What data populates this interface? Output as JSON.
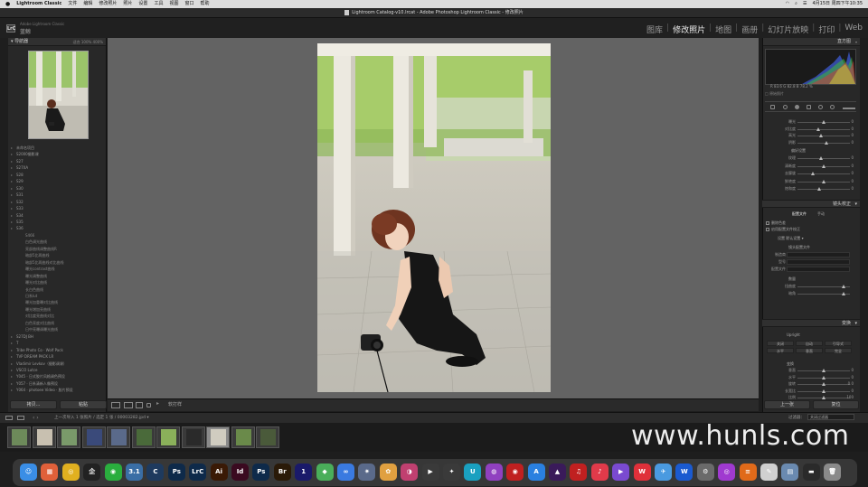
{
  "menubar": {
    "apple": "",
    "app_name": "Lightroom Classic",
    "menus": [
      "文件",
      "编辑",
      "修改照片",
      "照片",
      "设置",
      "工具",
      "视图",
      "窗口",
      "帮助"
    ],
    "clock": "4月15日 周四下午10:35"
  },
  "window": {
    "title": "Lightroom Catalog-v10.lrcat - Adobe Photoshop Lightroom Classic - 修改照片"
  },
  "identity": {
    "badge": "LrC",
    "line1": "Adobe Lightroom Classic",
    "line2": "蓝鲸"
  },
  "modules": {
    "items": [
      "图库",
      "修改照片",
      "地图",
      "画册",
      "幻灯片放映",
      "打印",
      "Web"
    ],
    "active": "修改照片"
  },
  "left_panel": {
    "navigator_label": "导航器",
    "navigator_opts": "适合  100%  400%",
    "folders": [
      {
        "label": "未命名项目",
        "sub": false
      },
      {
        "label": "S2000摄影课",
        "sub": false
      },
      {
        "label": "S27",
        "sub": false
      },
      {
        "label": "S27XA",
        "sub": false
      },
      {
        "label": "S28",
        "sub": false
      },
      {
        "label": "S29",
        "sub": false
      },
      {
        "label": "S30",
        "sub": false
      },
      {
        "label": "S31",
        "sub": false
      },
      {
        "label": "S32",
        "sub": false
      },
      {
        "label": "S33",
        "sub": false
      },
      {
        "label": "S34",
        "sub": false
      },
      {
        "label": "S35",
        "sub": false
      },
      {
        "label": "S36",
        "sub": false
      },
      {
        "label": "S466",
        "sub": true
      },
      {
        "label": "白色调光曲线",
        "sub": true
      },
      {
        "label": "亮部曲线调整曲线R",
        "sub": true
      },
      {
        "label": "暗部5比两曲线",
        "sub": true
      },
      {
        "label": "暗部5比两曲线对比曲线",
        "sub": true
      },
      {
        "label": "曝光contrast曲线",
        "sub": true
      },
      {
        "label": "曝光调整曲线",
        "sub": true
      },
      {
        "label": "曝光对比曲线",
        "sub": true
      },
      {
        "label": "长白色曲线",
        "sub": true
      },
      {
        "label": "日系lut",
        "sub": true
      },
      {
        "label": "曝光加重曝对比曲线",
        "sub": true
      },
      {
        "label": "曝光增加亮曲线",
        "sub": true
      },
      {
        "label": "对比度亮曲线对比",
        "sub": true
      },
      {
        "label": "白色亮度对比曲线",
        "sub": true
      },
      {
        "label": "日中亮曝调曝光曲线",
        "sub": true
      },
      {
        "label": "S27DJ BH",
        "sub": false
      },
      {
        "label": "T",
        "sub": false
      },
      {
        "label": "Tribe Photo Co · Wolf Pack",
        "sub": false
      },
      {
        "label": "TVP DREAM PACK LR",
        "sub": false
      },
      {
        "label": "Vladimir Levkov（摄影调课）",
        "sub": false
      },
      {
        "label": "VSCO Lutce",
        "sub": false
      },
      {
        "label": "Y045 · 日式胶片风格调色预设",
        "sub": false
      },
      {
        "label": "Y057 · 日系清新人像预设",
        "sub": false
      },
      {
        "label": "Y064 · photoee Video · 胶片预设",
        "sub": false
      }
    ],
    "copy_button": "拷贝...",
    "paste_button": "粘贴"
  },
  "toolbar": {
    "arrow": "▸",
    "label": "软打样"
  },
  "right_panel": {
    "histogram_label": "直方图",
    "histogram_colors": {
      "red": "#c04040",
      "green": "#40b040",
      "blue": "#4060e0",
      "yellow": "#c0c040"
    },
    "readout": "R 83.6  G 82.8  B 78.2 %",
    "original_label": "原始照片",
    "group1": [
      {
        "label": "曝光",
        "value": "0"
      },
      {
        "label": "对比度",
        "value": "0"
      },
      {
        "label": "高光",
        "value": "0"
      },
      {
        "label": "阴影",
        "value": "0"
      }
    ],
    "group1_knobs": [
      0.5,
      0.4,
      0.45,
      0.55
    ],
    "presence_label": "偏好设置",
    "group2": [
      {
        "label": "纹理",
        "value": "0"
      },
      {
        "label": "清晰度",
        "value": "0"
      },
      {
        "label": "去朦胧",
        "value": "0"
      },
      {
        "label": "鲜艳度",
        "value": "0"
      },
      {
        "label": "饱和度",
        "value": "0"
      }
    ],
    "group2_knobs": [
      0.45,
      0.5,
      0.3,
      0.5,
      0.42
    ],
    "lens_section": "镜头校正",
    "lens_tabs": [
      "配置文件",
      "手动"
    ],
    "lens_checks": [
      "删除色差",
      "启用配置文件校正"
    ],
    "setup_label": "设置",
    "setup_value": "默认设置",
    "lens_profile_label": "镜头配置文件",
    "lens_fields": [
      "制造商",
      "型号",
      "配置文件"
    ],
    "amount_label": "数量",
    "amount_fields": [
      "扭曲度",
      "暗角"
    ],
    "transform_section": "变换",
    "upright_label": "Upright",
    "upright_buttons": [
      "关闭",
      "自动",
      "引导式",
      "水平",
      "垂直",
      "完全"
    ],
    "transform_subhead": "变换",
    "transform_sliders": [
      {
        "label": "垂直",
        "value": "0"
      },
      {
        "label": "水平",
        "value": "0"
      },
      {
        "label": "旋转",
        "value": "0.0"
      },
      {
        "label": "长宽比",
        "value": "0"
      },
      {
        "label": "比例",
        "value": "100"
      }
    ],
    "prev_button": "上一张",
    "reset_button": "复位"
  },
  "filmstrip": {
    "info": "上一次导入   1 张照片 / 选定 1 张 / 00003282.jpd ▾",
    "filter_label": "过滤器：",
    "filter_value": "关闭过滤器",
    "thumb_count": 11,
    "selected_index": 8
  },
  "watermark": "www.hunls.com",
  "dock": {
    "apps": [
      {
        "name": "finder",
        "glyph": "☺",
        "color": "#3a8ee6"
      },
      {
        "name": "launchpad",
        "glyph": "▦",
        "color": "#e0603a"
      },
      {
        "name": "chrome",
        "glyph": "◎",
        "color": "#e0b020"
      },
      {
        "name": "qq",
        "glyph": "企",
        "color": "#222222"
      },
      {
        "name": "wechat",
        "glyph": "◉",
        "color": "#2aae3e"
      },
      {
        "name": "steam",
        "glyph": "3.1",
        "color": "#3a6ea5"
      },
      {
        "name": "lightroom-cc",
        "glyph": "C",
        "color": "#1e3a5e"
      },
      {
        "name": "photoshop",
        "glyph": "Ps",
        "color": "#0e2a4a"
      },
      {
        "name": "lightroom-classic",
        "glyph": "LrC",
        "color": "#0e2a4a"
      },
      {
        "name": "illustrator",
        "glyph": "Ai",
        "color": "#3a1a06"
      },
      {
        "name": "indesign",
        "glyph": "Id",
        "color": "#3a0a20"
      },
      {
        "name": "photoshop-beta",
        "glyph": "Ps",
        "color": "#0e2a4a"
      },
      {
        "name": "bridge",
        "glyph": "Br",
        "color": "#2a1a08"
      },
      {
        "name": "one-app",
        "glyph": "1",
        "color": "#1a1a6a"
      },
      {
        "name": "maps",
        "glyph": "◆",
        "color": "#4aae5a"
      },
      {
        "name": "baidu-netdisk",
        "glyph": "∞",
        "color": "#3a7ae0"
      },
      {
        "name": "system-prefs",
        "glyph": "✷",
        "color": "#5a6a8a"
      },
      {
        "name": "photos",
        "glyph": "✿",
        "color": "#e0a040"
      },
      {
        "name": "pixelmator",
        "glyph": "◑",
        "color": "#c04070"
      },
      {
        "name": "final-cut",
        "glyph": "▶",
        "color": "#3a3a3a"
      },
      {
        "name": "davinci",
        "glyph": "✦",
        "color": "#3a3a3a"
      },
      {
        "name": "airdrop",
        "glyph": "U",
        "color": "#1aa0c0"
      },
      {
        "name": "podcasts",
        "glyph": "◍",
        "color": "#9040c0"
      },
      {
        "name": "netease",
        "glyph": "◉",
        "color": "#c02020"
      },
      {
        "name": "app-store",
        "glyph": "A",
        "color": "#2a80e0"
      },
      {
        "name": "affinity",
        "glyph": "▲",
        "color": "#3a1a5a"
      },
      {
        "name": "netease-music",
        "glyph": "♫",
        "color": "#c02020"
      },
      {
        "name": "music",
        "glyph": "♪",
        "color": "#e03a4a"
      },
      {
        "name": "iina",
        "glyph": "▶",
        "color": "#7a4ad0"
      },
      {
        "name": "wps",
        "glyph": "W",
        "color": "#e0303a"
      },
      {
        "name": "mail-bird",
        "glyph": "✈",
        "color": "#4a9ae0"
      },
      {
        "name": "word-app",
        "glyph": "W",
        "color": "#1a5ad0"
      },
      {
        "name": "disk-utility",
        "glyph": "⚙",
        "color": "#6a6a6a"
      },
      {
        "name": "camera-app",
        "glyph": "◎",
        "color": "#a03ad0"
      },
      {
        "name": "stripes-app",
        "glyph": "≡",
        "color": "#e06a1a"
      },
      {
        "name": "textedit",
        "glyph": "✎",
        "color": "#d0d0d0"
      },
      {
        "name": "preview",
        "glyph": "▤",
        "color": "#6a8ab0"
      },
      {
        "name": "downloads",
        "glyph": "▬",
        "color": "#2a2a2a"
      },
      {
        "name": "trash",
        "glyph": "🗑",
        "color": "#8a8a8a"
      }
    ]
  }
}
